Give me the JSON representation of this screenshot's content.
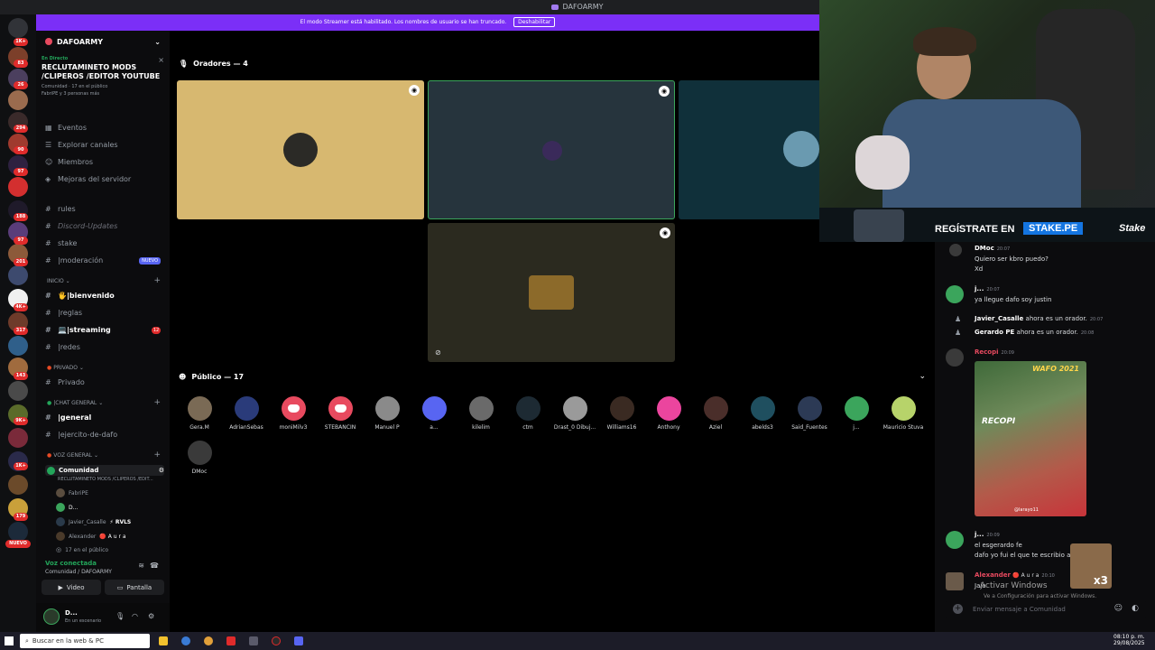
{
  "window": {
    "title": "DAFOARMY"
  },
  "banner": {
    "text": "El modo Streamer está habilitado. Los nombres de usuario se han truncado.",
    "button": "Deshabilitar"
  },
  "server": {
    "name": "DAFOARMY"
  },
  "rail_badges": [
    "1K+",
    "83",
    "26",
    "294",
    "90",
    "97",
    "188",
    "97",
    "201",
    "4K+",
    "317",
    "143",
    "9K+",
    "1K+",
    "179"
  ],
  "rail_new": "NUEVO",
  "live_event": {
    "tag": "En Directo",
    "title_line1": "RECLUTAMINETO MODS",
    "title_line2": "/CLIPEROS /EDITOR YOUTUBE",
    "meta1": "Comunidad · 17 en el público",
    "meta2": "FabriPE y 3 personas más"
  },
  "nav": {
    "events": "Eventos",
    "explore": "Explorar canales",
    "members": "Miembros",
    "boosts": "Mejoras del servidor"
  },
  "channels": {
    "rules": "rules",
    "updates": "Discord-Updates",
    "stake": "stake",
    "moderacion": "|moderación",
    "new_badge": "NUEVO"
  },
  "categories": {
    "inicio": "INICIO",
    "privado": "PRIVADO",
    "chat_general": "|CHAT GENERAL",
    "voz_general": "VOZ GENERAL"
  },
  "inicio_channels": [
    "🖐|bienvenido",
    "|reglas",
    "💻|streaming",
    "|redes"
  ],
  "streaming_count": "12",
  "privado_channel": "Privado",
  "chat_channels": [
    "|general",
    "|ejercito-de-dafo"
  ],
  "voice": {
    "channel": "Comunidad",
    "subtitle": "RECLUTAMINETO MODS /CLIPEROS /EDIT...",
    "users": [
      "FabriPE",
      "D...",
      "Javier_Casalle",
      "Alexander"
    ],
    "rvls": "⚡ RVLS",
    "aura": "🔴 A u r a",
    "public_count": "17 en el público"
  },
  "voice_panel": {
    "status": "Voz conectada",
    "location": "Comunidad / DAFOARMY",
    "video": "Video",
    "screen": "Pantalla"
  },
  "user_panel": {
    "name": "D...",
    "status": "En un escenario"
  },
  "stage": {
    "speakers_title": "Oradores — 4",
    "public_title": "Público — 17"
  },
  "audience": [
    {
      "name": "Gera.M",
      "color": "#7a6a55"
    },
    {
      "name": "AdrianSebas",
      "color": "#2a3b7a"
    },
    {
      "name": "moniMilv3",
      "color": "disc"
    },
    {
      "name": "STEBANCIN",
      "color": "disc"
    },
    {
      "name": "Manuel P",
      "color": "#8a8a8a"
    },
    {
      "name": "a...",
      "color": "#5865f2"
    },
    {
      "name": "kilelim",
      "color": "#6a6a6a"
    },
    {
      "name": "ctm",
      "color": "#1d2a33"
    },
    {
      "name": "Drast_0 Dibuj...",
      "color": "#9a9a9a"
    },
    {
      "name": "Williams16",
      "color": "#3a2a22"
    },
    {
      "name": "Anthony",
      "color": "#eb459e"
    },
    {
      "name": "Aziel",
      "color": "#4a2e2a"
    },
    {
      "name": "abelds3",
      "color": "#1f4f5f"
    },
    {
      "name": "Said_Fuentes",
      "color": "#2c3a55"
    },
    {
      "name": "j...",
      "color": "#3ba55c"
    },
    {
      "name": "Mauricio Stuva",
      "color": "#b7d36a"
    },
    {
      "name": "DMoc",
      "color": "#3a3a3a"
    }
  ],
  "webcam": {
    "cta": "REGÍSTRATE EN",
    "site": "STAKE.PE",
    "brand": "Stake"
  },
  "chat": {
    "messages": [
      {
        "name": "DMoc",
        "time": "20:07",
        "lines": [
          "Quiero ser kbro puedo?",
          "Xd"
        ]
      },
      {
        "name": "j...",
        "time": "20:07",
        "lines": [
          "ya llegue dafo soy justin"
        ]
      },
      {
        "name": "Javier_Casalle",
        "text": "ahora es un orador.",
        "time": "20:07"
      },
      {
        "name": "Gerardo PE",
        "text": "ahora es un orador.",
        "time": "20:08"
      },
      {
        "name": "Recopi",
        "time": "20:09"
      },
      {
        "name": "j...",
        "time": "20:09",
        "lines": [
          "el esgerardo fe",
          "dafo yo fui el que te escribio al i..."
        ]
      },
      {
        "name": "Alexander",
        "aura": "🔴 A u r a",
        "time": "20:10",
        "lines": [
          "Jaja"
        ]
      }
    ],
    "image": {
      "line1": "WAFO 2021",
      "line2": "RECOPI",
      "handle": "@larayo11"
    },
    "overlay_x": "x3",
    "activate_title": "Activar Windows",
    "activate_sub": "Ve a Configuración para activar Windows.",
    "placeholder": "Enviar mensaje a Comunidad"
  },
  "taskbar": {
    "search": "Buscar en la web & PC",
    "time": "08:10 p. m.",
    "date": "29/08/2025"
  }
}
